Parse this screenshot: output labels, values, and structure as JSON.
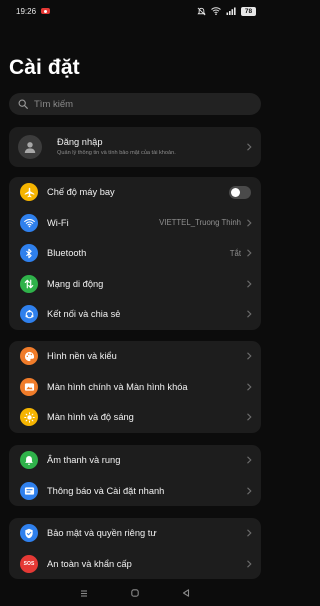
{
  "status_bar": {
    "time": "19:26",
    "battery": "78"
  },
  "page_title": "Cài đặt",
  "search": {
    "placeholder": "Tìm kiếm"
  },
  "account": {
    "title": "Đăng nhập",
    "subtitle": "Quản lý thông tin và tính bảo mật của tài khoản."
  },
  "groups": {
    "network": [
      {
        "label": "Chế độ máy bay",
        "icon": "airplane-icon",
        "color": "#f5b400",
        "toggle": false
      },
      {
        "label": "Wi-Fi",
        "icon": "wifi-icon",
        "color": "#2f80ed",
        "value": "VIETTEL_Truong Thinh"
      },
      {
        "label": "Bluetooth",
        "icon": "bluetooth-icon",
        "color": "#2f80ed",
        "value": "Tắt"
      },
      {
        "label": "Mạng di động",
        "icon": "mobile-data-icon",
        "color": "#2fb24a"
      },
      {
        "label": "Kết nối và chia sẻ",
        "icon": "connection-sharing-icon",
        "color": "#2f80ed"
      }
    ],
    "display": [
      {
        "label": "Hình nền và kiểu",
        "icon": "palette-icon",
        "color": "#f07c2a"
      },
      {
        "label": "Màn hình chính và Màn hình khóa",
        "icon": "home-screen-icon",
        "color": "#f07c2a"
      },
      {
        "label": "Màn hình và độ sáng",
        "icon": "brightness-icon",
        "color": "#f5b400"
      }
    ],
    "sound": [
      {
        "label": "Âm thanh và rung",
        "icon": "bell-icon",
        "color": "#2fb24a"
      },
      {
        "label": "Thông báo và Cài đặt nhanh",
        "icon": "notification-icon",
        "color": "#2f80ed"
      }
    ],
    "security": [
      {
        "label": "Bảo mật và quyền riêng tư",
        "icon": "shield-icon",
        "color": "#2f80ed"
      },
      {
        "label": "An toàn và khẩn cấp",
        "icon": "sos-icon",
        "color": "#e53935",
        "badge": "SOS"
      }
    ]
  }
}
